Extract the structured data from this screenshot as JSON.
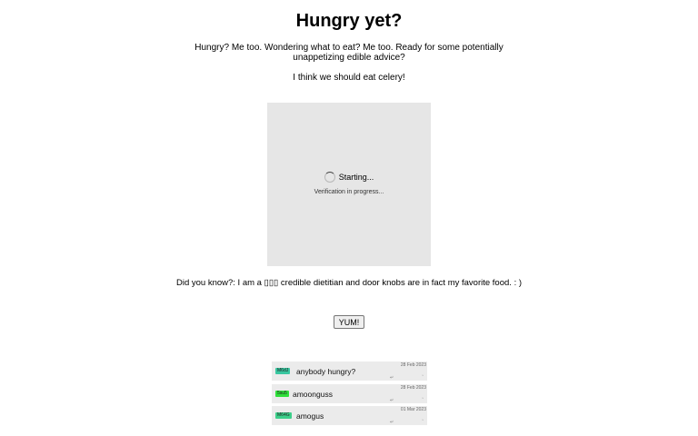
{
  "header": {
    "title": "Hungry yet?"
  },
  "intro": {
    "text": "Hungry? Me too. Wondering what to eat? Me too. Ready for some potentially unappetizing edible advice?",
    "suggestion": "I think we should eat celery!"
  },
  "verification": {
    "status": "Starting...",
    "message": "Verification in progress..."
  },
  "fact": {
    "text": "Did you know?: I am a ▯▯▯ credible dietitian and door knobs are in fact my favorite food. : )"
  },
  "yum_button": {
    "label": "YUM!"
  },
  "comments": [
    {
      "tag": "M6dJ",
      "tag_color": "#39c7a0",
      "text": "anybody hungry?",
      "date": "28 Feb 2023",
      "reply": "↵",
      "more": "ˇ"
    },
    {
      "tag": "5su5",
      "tag_color": "#2fe03a",
      "text": "amoonguss",
      "date": "28 Feb 2023",
      "reply": "↵",
      "more": "ˇ"
    },
    {
      "tag": "M64G",
      "tag_color": "#3ccf8a",
      "text": "amogus",
      "date": "01 Mar 2023",
      "reply": "↵",
      "more": "ˇ"
    }
  ]
}
